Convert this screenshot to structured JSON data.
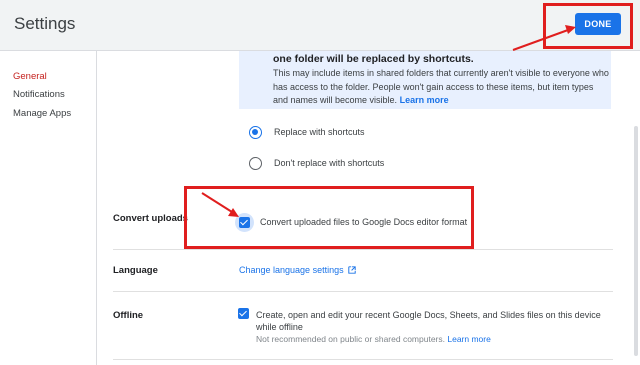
{
  "header": {
    "title": "Settings",
    "done_label": "DONE"
  },
  "sidebar": {
    "items": [
      {
        "label": "General",
        "active": true
      },
      {
        "label": "Notifications",
        "active": false
      },
      {
        "label": "Manage Apps",
        "active": false
      }
    ]
  },
  "info": {
    "heading": "one folder will be replaced by shortcuts.",
    "body": "This may include items in shared folders that currently aren't visible to everyone who has access to the folder. People won't gain access to these items, but item types and names will become visible.",
    "link": "Learn more"
  },
  "shortcuts_options": [
    {
      "label": "Replace with shortcuts",
      "checked": true
    },
    {
      "label": "Don't replace with shortcuts",
      "checked": false
    }
  ],
  "convert": {
    "label": "Convert uploads",
    "option": "Convert uploaded files to Google Docs editor format",
    "checked": true
  },
  "language": {
    "label": "Language",
    "link": "Change language settings"
  },
  "offline": {
    "label": "Offline",
    "text": "Create, open and edit your recent Google Docs, Sheets, and Slides files on this device while offline",
    "note": "Not recommended on public or shared computers.",
    "note_link": "Learn more",
    "checked": true
  },
  "colors": {
    "accent": "#1a73e8",
    "highlight": "#e01e1e",
    "active_nav": "#c5221f"
  },
  "icons": {
    "external_link": "open-in-new-icon"
  }
}
